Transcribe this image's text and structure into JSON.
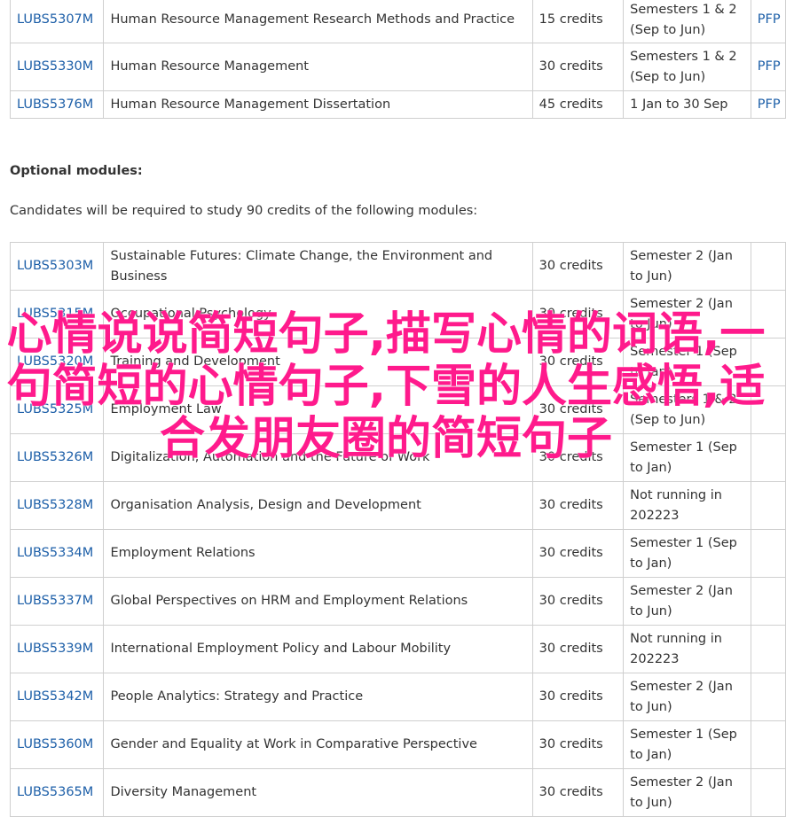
{
  "required_modules": [
    {
      "code": "LUBS5307M",
      "title": "Human Resource Management Research Methods and Practice",
      "credits": "15 credits",
      "semester": "Semesters 1 & 2 (Sep to Jun)",
      "pfp": "PFP"
    },
    {
      "code": "LUBS5330M",
      "title": "Human Resource Management",
      "credits": "30 credits",
      "semester": "Semesters 1 & 2 (Sep to Jun)",
      "pfp": "PFP"
    },
    {
      "code": "LUBS5376M",
      "title": "Human Resource Management Dissertation",
      "credits": "45 credits",
      "semester": "1 Jan to 30 Sep",
      "pfp": "PFP"
    }
  ],
  "optional": {
    "heading": "Optional modules:",
    "description": "Candidates will be required to study 90 credits of the following modules:"
  },
  "optional_modules": [
    {
      "code": "LUBS5303M",
      "title": "Sustainable Futures: Climate Change, the Environment and Business",
      "credits": "30 credits",
      "semester": "Semester 2 (Jan to Jun)"
    },
    {
      "code": "LUBS5315M",
      "title": "Occupational Psychology",
      "credits": "30 credits",
      "semester": "Semester 2 (Jan to Jun)"
    },
    {
      "code": "LUBS5320M",
      "title": "Training and Development",
      "credits": "30 credits",
      "semester": "Semester 1 (Sep to Jan)"
    },
    {
      "code": "LUBS5325M",
      "title": "Employment Law",
      "credits": "30 credits",
      "semester": "Semesters 1 & 2 (Sep to Jun)"
    },
    {
      "code": "LUBS5326M",
      "title": "Digitalization, Automation and the Future of Work",
      "credits": "30 credits",
      "semester": "Semester 1 (Sep to Jan)"
    },
    {
      "code": "LUBS5328M",
      "title": "Organisation Analysis, Design and Development",
      "credits": "30 credits",
      "semester": "Not running in 202223"
    },
    {
      "code": "LUBS5334M",
      "title": "Employment Relations",
      "credits": "30 credits",
      "semester": "Semester 1 (Sep to Jan)"
    },
    {
      "code": "LUBS5337M",
      "title": "Global Perspectives on HRM and Employment Relations",
      "credits": "30 credits",
      "semester": "Semester 2 (Jan to Jun)"
    },
    {
      "code": "LUBS5339M",
      "title": "International Employment Policy and Labour Mobility",
      "credits": "30 credits",
      "semester": "Not running in 202223"
    },
    {
      "code": "LUBS5342M",
      "title": "People Analytics: Strategy and Practice",
      "credits": "30 credits",
      "semester": "Semester 2 (Jan to Jun)"
    },
    {
      "code": "LUBS5360M",
      "title": "Gender and Equality at Work in Comparative Perspective",
      "credits": "30 credits",
      "semester": "Semester 1 (Sep to Jan)"
    },
    {
      "code": "LUBS5365M",
      "title": "Diversity Management",
      "credits": "30 credits",
      "semester": "Semester 2 (Jan to Jun)"
    }
  ],
  "overlay_text": "心情说说简短句子,描写心情的词语,一句简短的心情句子,下雪的人生感悟,适合发朋友圈的简短句子",
  "colors": {
    "link": "#1d5fa8",
    "overlay": "#ff1a8c",
    "border": "#cfcfcf"
  }
}
